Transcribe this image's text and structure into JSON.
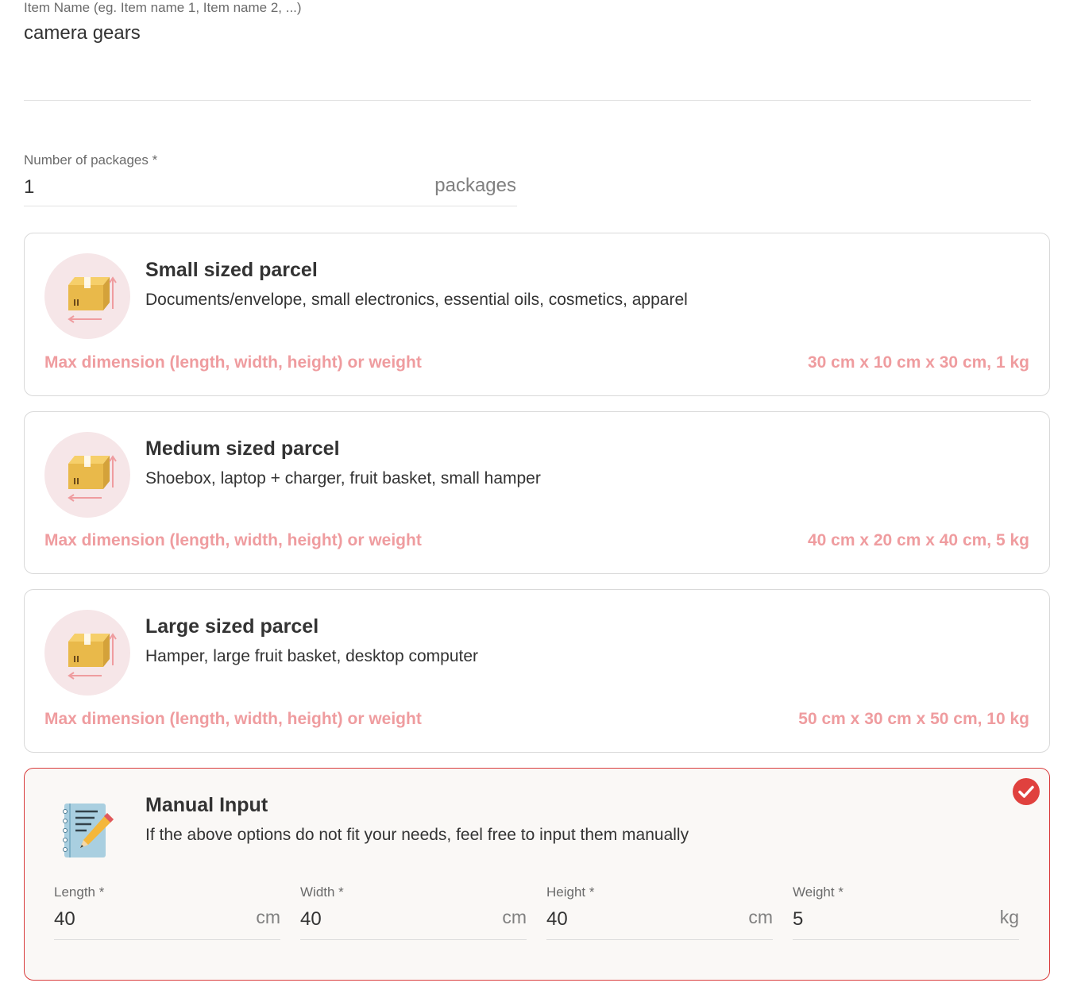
{
  "item_name": {
    "label": "Item Name (eg. Item name 1, Item name 2, ...)",
    "value": "camera gears"
  },
  "packages": {
    "label": "Number of packages *",
    "value": "1",
    "unit": "packages"
  },
  "parcels": [
    {
      "title": "Small sized parcel",
      "description": "Documents/envelope, small electronics, essential oils, cosmetics, apparel",
      "dimension_label": "Max dimension (length, width, height) or weight",
      "dimension_value": "30 cm x 10 cm x 30 cm, 1 kg",
      "icon": "parcel-box-icon"
    },
    {
      "title": "Medium sized parcel",
      "description": "Shoebox, laptop + charger, fruit basket, small hamper",
      "dimension_label": "Max dimension (length, width, height) or weight",
      "dimension_value": "40 cm x 20 cm x 40 cm, 5 kg",
      "icon": "parcel-box-icon"
    },
    {
      "title": "Large sized parcel",
      "description": "Hamper, large fruit basket, desktop computer",
      "dimension_label": "Max dimension (length, width, height) or weight",
      "dimension_value": "50 cm x 30 cm x 50 cm, 10 kg",
      "icon": "parcel-box-icon"
    }
  ],
  "manual": {
    "title": "Manual Input",
    "description": "If the above options do not fit your needs, feel free to input them manually",
    "selected": true,
    "icon": "notepad-pencil-icon",
    "fields": [
      {
        "label": "Length *",
        "value": "40",
        "unit": "cm"
      },
      {
        "label": "Width *",
        "value": "40",
        "unit": "cm"
      },
      {
        "label": "Height *",
        "value": "40",
        "unit": "cm"
      },
      {
        "label": "Weight *",
        "value": "5",
        "unit": "kg"
      }
    ]
  },
  "colors": {
    "accent": "#d93c3c",
    "dimension_text": "#ef9c9f",
    "icon_bg": "#f6e6e8"
  }
}
